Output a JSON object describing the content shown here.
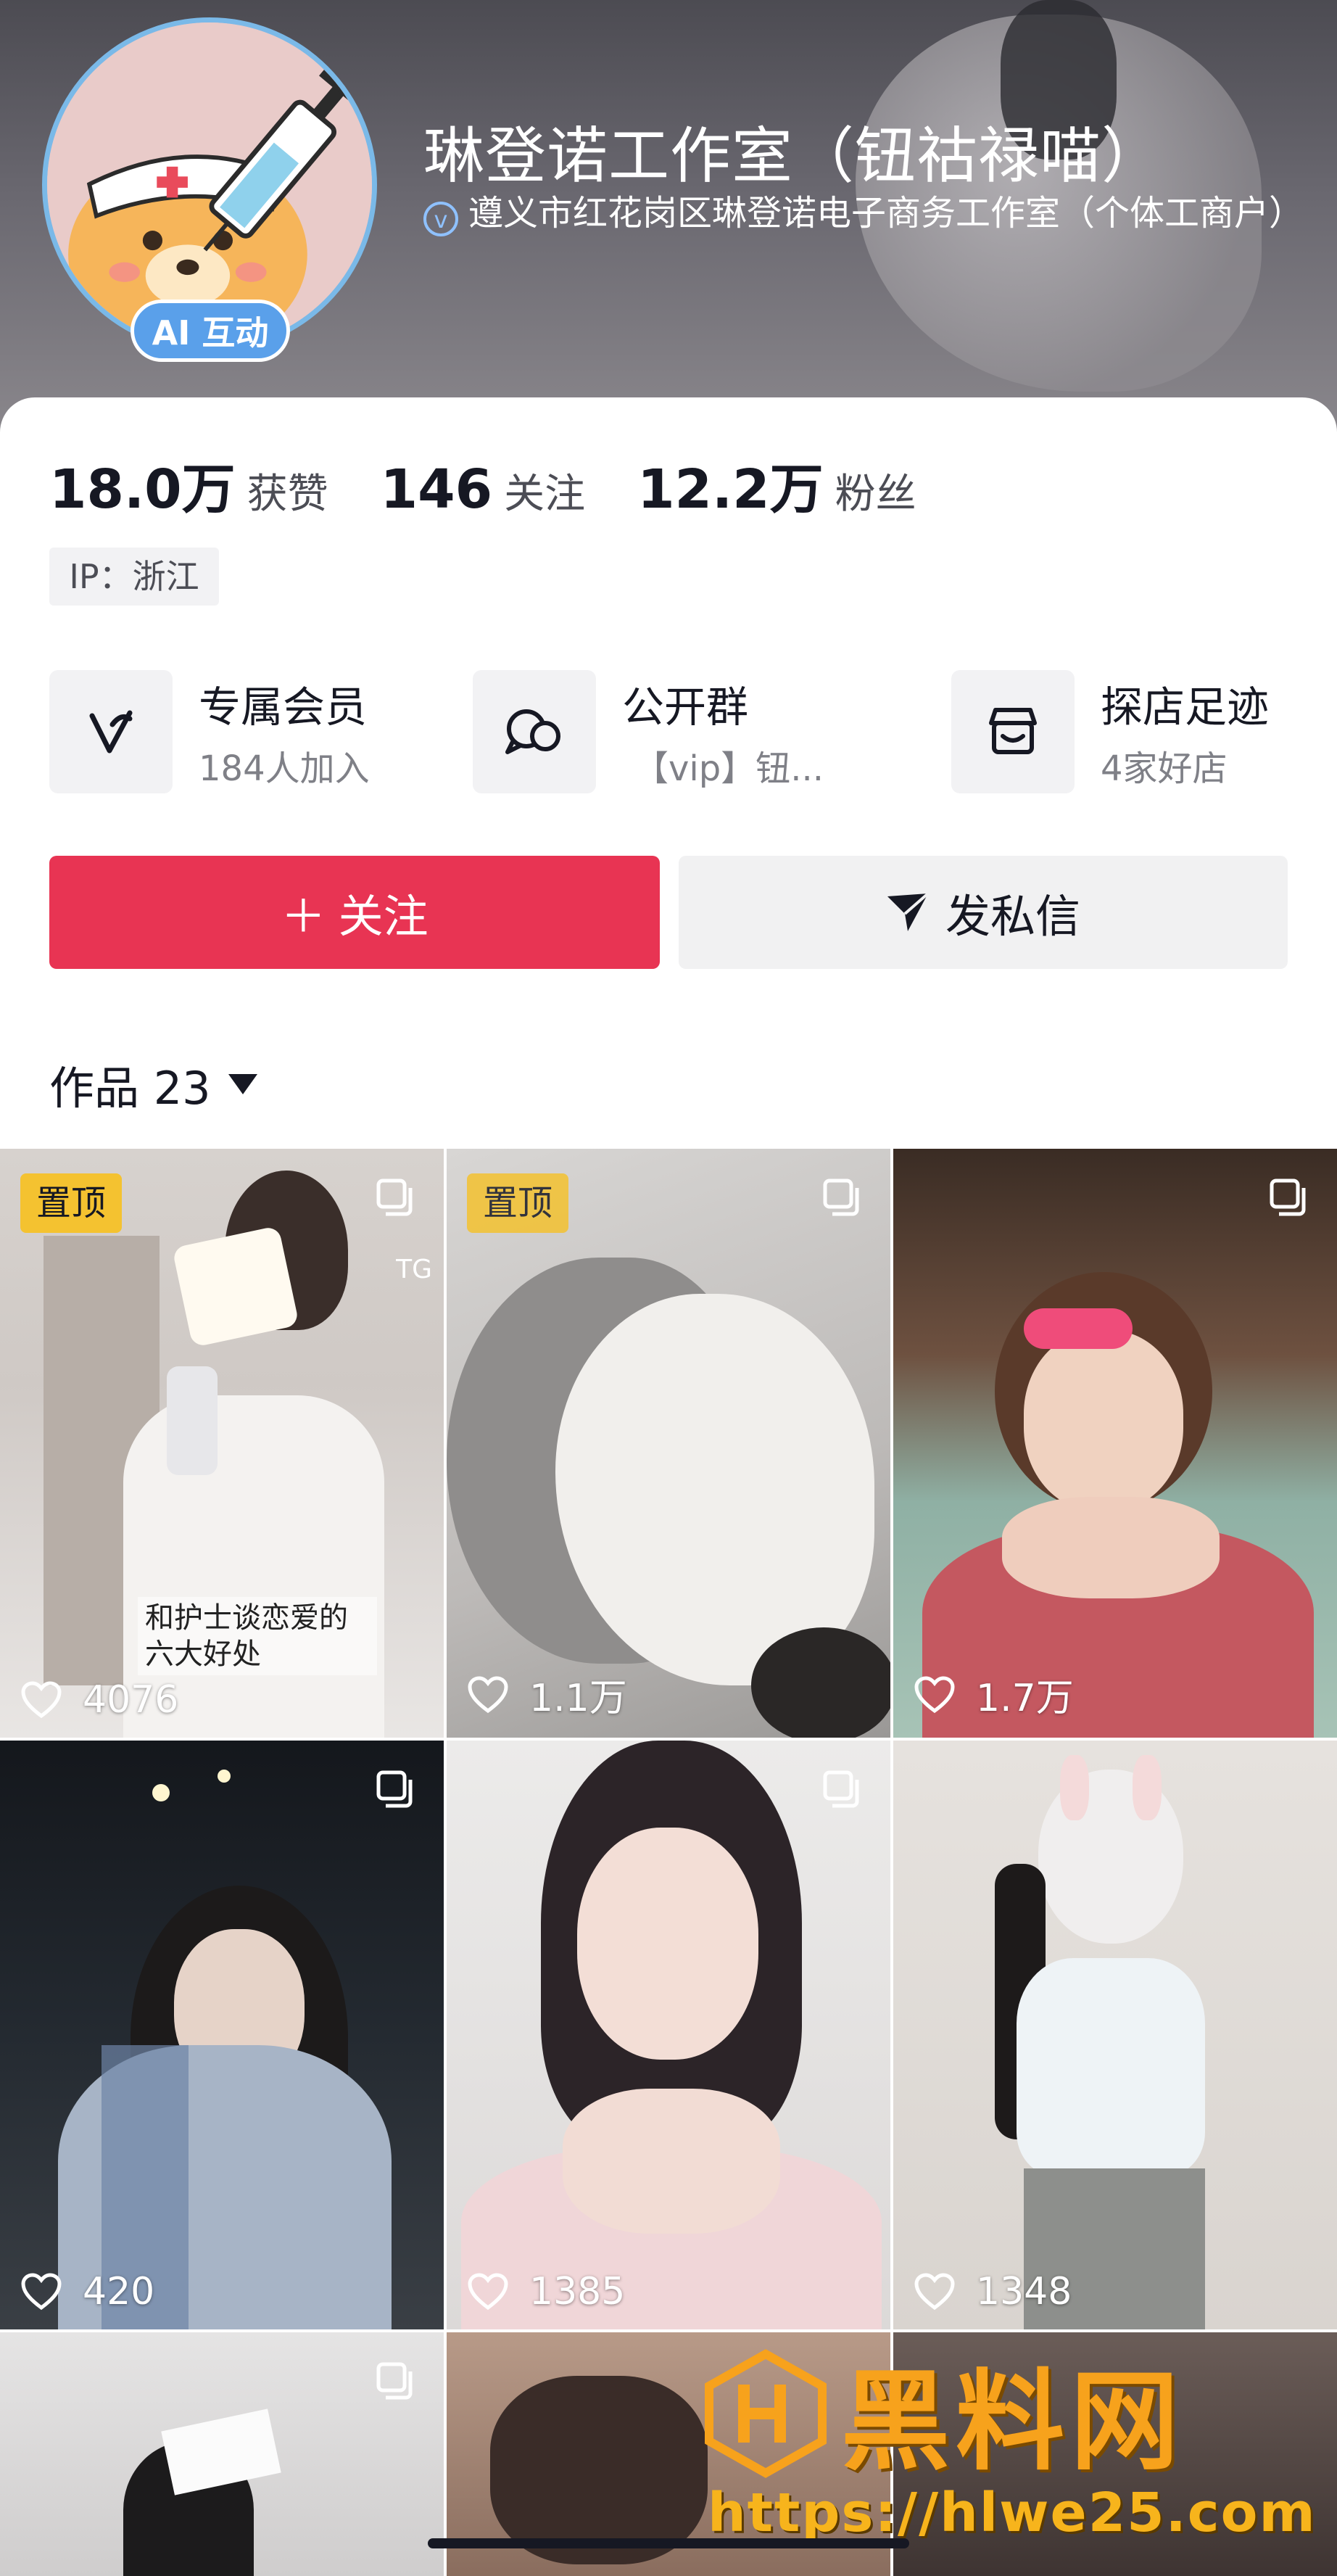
{
  "profile": {
    "name": "琳登诺工作室（钮祜禄喵）",
    "verified_text": "遵义市红花岗区琳登诺电子商务工作室（个体工商户）",
    "avatar_badge": "AI 互动"
  },
  "stats": [
    {
      "value": "18.0万",
      "label": "获赞"
    },
    {
      "value": "146",
      "label": "关注"
    },
    {
      "value": "12.2万",
      "label": "粉丝"
    }
  ],
  "ip_location": "IP：浙江",
  "features": [
    {
      "icon": "heart-check-icon",
      "title": "专属会员",
      "subtitle": "184人加入"
    },
    {
      "icon": "chat-bubbles-icon",
      "title": "公开群",
      "subtitle": "【vip】钮..."
    },
    {
      "icon": "storefront-icon",
      "title": "探店足迹",
      "subtitle": "4家好店"
    }
  ],
  "actions": {
    "follow_label": "＋ 关注",
    "message_label": "发私信"
  },
  "works": {
    "label": "作品 23"
  },
  "videos": [
    {
      "likes": "4076",
      "pinned_label": "置顶",
      "caption": "和护士谈恋爱的六大好处",
      "corner_text": "TG",
      "multi": true
    },
    {
      "likes": "1.1万",
      "pinned_label": "置顶",
      "multi": true
    },
    {
      "likes": "1.7万",
      "multi": true
    },
    {
      "likes": "420",
      "multi": true
    },
    {
      "likes": "1385",
      "multi": true
    },
    {
      "likes": "1348",
      "multi": false
    },
    {
      "multi": true
    },
    {
      "multi": false
    }
  ],
  "watermark": {
    "brand": "黑料网",
    "url": "https://hlwe25.com"
  },
  "colors": {
    "follow_button": "#e83453",
    "badge_blue": "#5aa0ea",
    "pin_yellow": "#f4c230",
    "watermark_orange": "#f7a21c"
  }
}
